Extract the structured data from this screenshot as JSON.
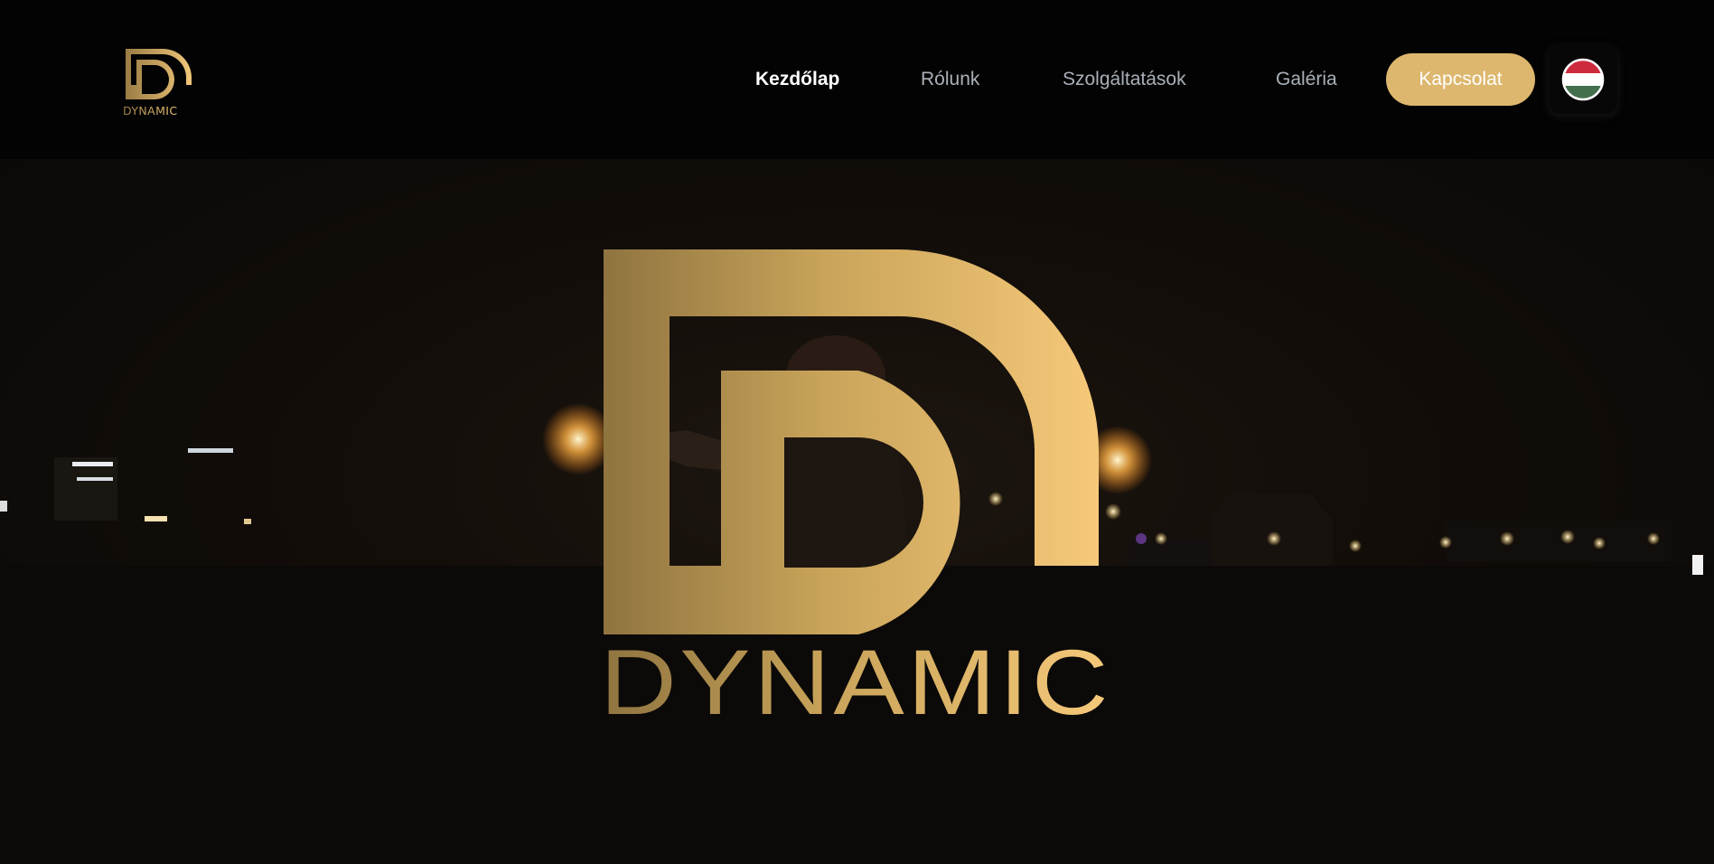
{
  "brand": {
    "name": "DYNAMIC",
    "gold_dark": "#8f7440",
    "gold_mid": "#c9a45a",
    "gold_light": "#f6c97a"
  },
  "nav": {
    "items": [
      {
        "label": "Kezdőlap",
        "active": true
      },
      {
        "label": "Rólunk",
        "active": false
      },
      {
        "label": "Szolgáltatások",
        "active": false
      },
      {
        "label": "Galéria",
        "active": false
      }
    ],
    "contact_label": "Kapcsolat",
    "language_flag": "hungary-flag-icon"
  },
  "colors": {
    "header_bg": "#030303",
    "accent": "#ddb76d",
    "nav_text": "#a9b0b8",
    "nav_active": "#ffffff"
  },
  "hero": {
    "logo_text": "DYNAMIC",
    "background": "night-fire-performance-photo"
  }
}
